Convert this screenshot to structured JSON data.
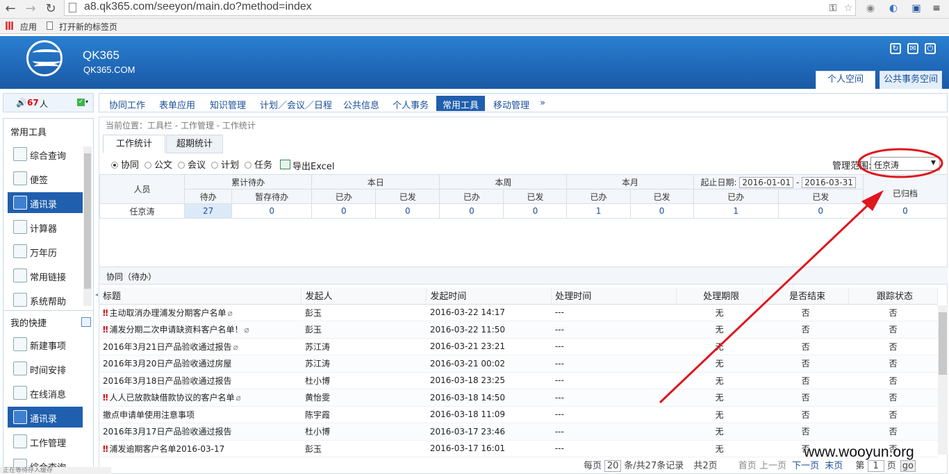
{
  "browser": {
    "url": "a8.qk365.com/seeyon/main.do?method=index",
    "bookmarks": [
      "应用",
      "打开新的标签页"
    ]
  },
  "header": {
    "brand": "QK365",
    "domain": "QK365.COM",
    "tabs": [
      "个人空间",
      "公共事务空间"
    ]
  },
  "notice": {
    "icon": "speaker-icon",
    "count": "67",
    "unit": "人"
  },
  "menu": [
    "协同工作",
    "表单应用",
    "知识管理",
    "计划／会议／日程",
    "公共信息",
    "个人事务",
    "常用工具",
    "移动管理",
    "»"
  ],
  "sidebar": {
    "tools_title": "常用工具",
    "tools": [
      "综合查询",
      "便签",
      "通讯录",
      "计算器",
      "万年历",
      "常用链接",
      "系统帮助"
    ],
    "shortcut_title": "我的快捷",
    "shortcuts": [
      "新建事项",
      "时间安排",
      "在线消息",
      "通讯录",
      "工作管理",
      "综合查询"
    ]
  },
  "breadcrumb": "当前位置：工具栏 - 工作管理 - 工作统计",
  "subtabs": [
    "工作统计",
    "超期统计"
  ],
  "filters": [
    "协同",
    "公文",
    "会议",
    "计划",
    "任务"
  ],
  "export_label": "导出Excel",
  "scope": {
    "label": "管理范围:",
    "value": "任京涛"
  },
  "stats": {
    "person_header": "人员",
    "groups": [
      "累计待办",
      "本日",
      "本周",
      "本月"
    ],
    "date_label": "起止日期:",
    "date_from": "2016-01-01",
    "date_to": "2016-03-31",
    "sep": "-",
    "archived": "已归档",
    "subheaders": [
      "待办",
      "暂存待办",
      "已办",
      "已发",
      "已办",
      "已发",
      "已办",
      "已发",
      "已办",
      "已发"
    ],
    "row": {
      "name": "任京涛",
      "values": [
        "27",
        "0",
        "0",
        "0",
        "0",
        "0",
        "1",
        "0",
        "1",
        "0",
        "0"
      ]
    }
  },
  "list": {
    "title": "协同（待办）",
    "columns": [
      "标题",
      "发起人",
      "发起时间",
      "处理时间",
      "处理期限",
      "是否结束",
      "跟踪状态"
    ],
    "rows": [
      {
        "imp": "‼",
        "title": "主动取消办理浦发分期客户名单",
        "att": "📎",
        "who": "彭玉",
        "start": "2016-03-22 14:17",
        "proc": "---",
        "lim": "无",
        "end": "否",
        "track": "否"
      },
      {
        "imp": "‼",
        "title": "浦发分期二次申请缺资料客户名单！",
        "att": "📎",
        "who": "彭玉",
        "start": "2016-03-22 11:50",
        "proc": "---",
        "lim": "无",
        "end": "否",
        "track": "否"
      },
      {
        "imp": "",
        "title": "2016年3月21日产品验收通过报告",
        "att": "📎",
        "who": "苏江涛",
        "start": "2016-03-21 23:21",
        "proc": "---",
        "lim": "无",
        "end": "否",
        "track": "否"
      },
      {
        "imp": "",
        "title": "2016年3月20日产品验收通过房屋",
        "att": "",
        "who": "苏江涛",
        "start": "2016-03-21 00:02",
        "proc": "---",
        "lim": "无",
        "end": "否",
        "track": "否"
      },
      {
        "imp": "",
        "title": "2016年3月18日产品验收通过报告",
        "att": "",
        "who": "杜小博",
        "start": "2016-03-18 23:25",
        "proc": "---",
        "lim": "无",
        "end": "否",
        "track": "否"
      },
      {
        "imp": "‼",
        "title": "人人已放款缺借款协议的客户名单",
        "att": "📎",
        "who": "黄怡雯",
        "start": "2016-03-18 14:50",
        "proc": "---",
        "lim": "无",
        "end": "否",
        "track": "否"
      },
      {
        "imp": "",
        "title": "撤点申请单使用注意事项",
        "att": "",
        "who": "陈宇霞",
        "start": "2016-03-18 11:09",
        "proc": "---",
        "lim": "无",
        "end": "否",
        "track": "否"
      },
      {
        "imp": "",
        "title": "2016年3月17日产品验收通过报告",
        "att": "",
        "who": "杜小博",
        "start": "2016-03-17 23:46",
        "proc": "---",
        "lim": "无",
        "end": "否",
        "track": "否"
      },
      {
        "imp": "‼",
        "title": "浦发逾期客户名单2016-03-17",
        "att": "",
        "who": "彭玉",
        "start": "2016-03-17 16:01",
        "proc": "---",
        "lim": "无",
        "end": "否",
        "track": "否"
      }
    ]
  },
  "pager": {
    "per_page_pre": "每页",
    "per_page": "20",
    "per_page_post": "条/共27条记录",
    "pages": "共2页",
    "first": "首页",
    "prev": "上一页",
    "next": "下一页",
    "last": "末页",
    "page_pre": "第",
    "page": "1",
    "page_post": "页",
    "go": "go"
  },
  "status_text": "正在等待存入缓存",
  "watermark": "www.wooyun.org",
  "colors": {
    "header": "#1e64b4",
    "active_menu": "#1f5fae",
    "annotation": "#e0161e"
  }
}
